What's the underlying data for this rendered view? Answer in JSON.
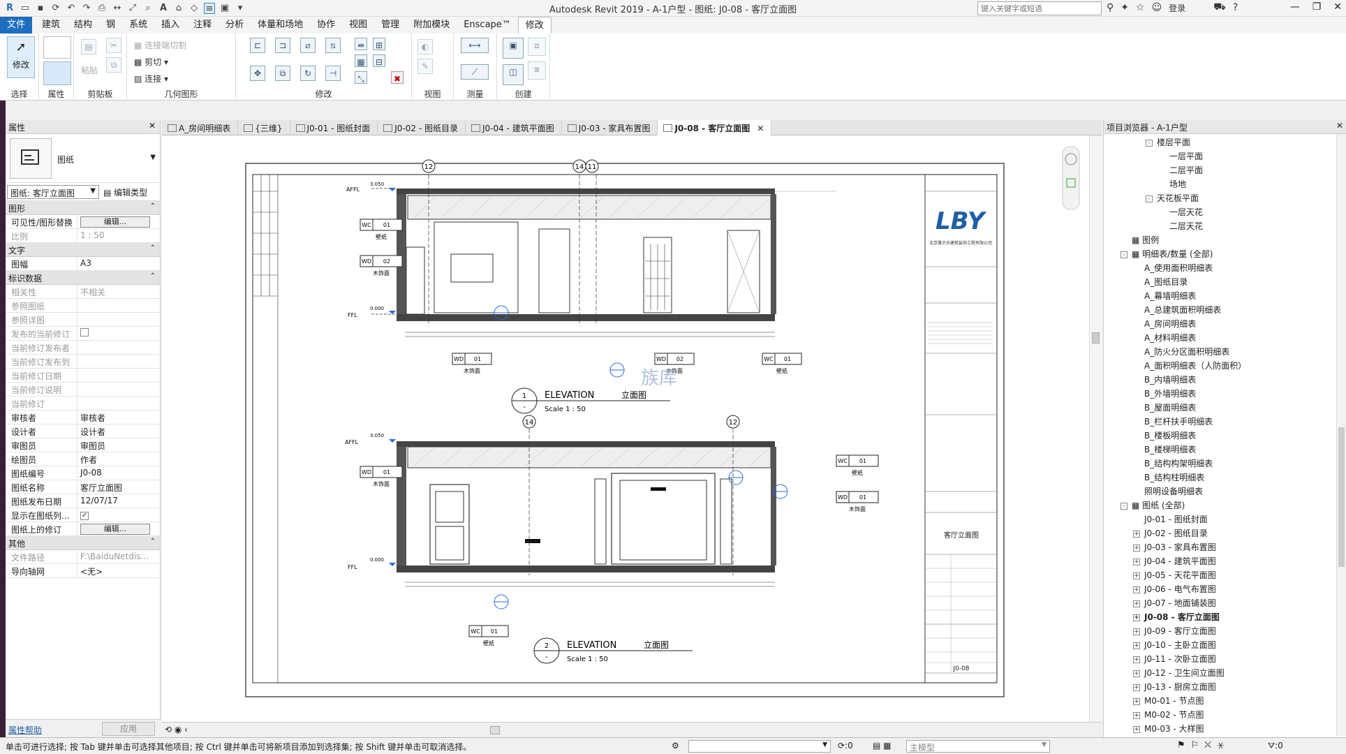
{
  "app": {
    "title": "Autodesk Revit 2019 - A-1户型 - 图纸: J0-08 - 客厅立面图",
    "search_placeholder": "键入关键字或短语",
    "login": "登录"
  },
  "menu": [
    "文件",
    "建筑",
    "结构",
    "钢",
    "系统",
    "插入",
    "注释",
    "分析",
    "体量和场地",
    "协作",
    "视图",
    "管理",
    "附加模块",
    "Enscape™",
    "修改"
  ],
  "ribbon": {
    "panels": [
      "选择",
      "属性",
      "剪贴板",
      "几何图形",
      "修改",
      "视图",
      "测量",
      "创建"
    ],
    "modify_label": "修改",
    "paste_label": "粘贴",
    "cut_label": "剪切",
    "join_label": "连接",
    "cutjoin_label": "连接端切割"
  },
  "properties": {
    "title": "属性",
    "family": "图纸",
    "selector": "图纸: 客厅立面图",
    "edit_type": "编辑类型",
    "sections": [
      {
        "name": "图形",
        "rows": [
          {
            "k": "可见性/图形替换",
            "v": "编辑...",
            "btn": true
          },
          {
            "k": "比例",
            "v": "1 : 50",
            "dim": true
          }
        ]
      },
      {
        "name": "文字",
        "rows": [
          {
            "k": "图幅",
            "v": "A3"
          }
        ]
      },
      {
        "name": "标识数据",
        "rows": [
          {
            "k": "相关性",
            "v": "不相关",
            "dim": true
          },
          {
            "k": "参照图纸",
            "v": "",
            "dim": true
          },
          {
            "k": "参照详图",
            "v": "",
            "dim": true
          },
          {
            "k": "发布的当前修订",
            "v": "",
            "dim": true,
            "chk": true,
            "checked": false
          },
          {
            "k": "当前修订发布者",
            "v": "",
            "dim": true
          },
          {
            "k": "当前修订发布到",
            "v": "",
            "dim": true
          },
          {
            "k": "当前修订日期",
            "v": "",
            "dim": true
          },
          {
            "k": "当前修订说明",
            "v": "",
            "dim": true
          },
          {
            "k": "当前修订",
            "v": "",
            "dim": true
          },
          {
            "k": "审核者",
            "v": "审核者"
          },
          {
            "k": "设计者",
            "v": "设计者"
          },
          {
            "k": "审图员",
            "v": "审图员"
          },
          {
            "k": "绘图员",
            "v": "作者"
          },
          {
            "k": "图纸编号",
            "v": "J0-08"
          },
          {
            "k": "图纸名称",
            "v": "客厅立面图"
          },
          {
            "k": "图纸发布日期",
            "v": "12/07/17"
          },
          {
            "k": "显示在图纸列...",
            "v": "",
            "chk": true,
            "checked": true
          },
          {
            "k": "图纸上的修订",
            "v": "编辑...",
            "btn": true
          }
        ]
      },
      {
        "name": "其他",
        "rows": [
          {
            "k": "文件路径",
            "v": "F:\\BaiduNetdis...",
            "dim": true
          },
          {
            "k": "导向轴网",
            "v": "<无>"
          }
        ]
      }
    ],
    "help": "属性帮助",
    "apply": "应用"
  },
  "tabs": [
    {
      "label": "A_房间明细表",
      "active": false
    },
    {
      "label": "{三维}",
      "active": false
    },
    {
      "label": "J0-01 - 图纸封面",
      "active": false
    },
    {
      "label": "J0-02 - 图纸目录",
      "active": false
    },
    {
      "label": "J0-04 - 建筑平面图",
      "active": false
    },
    {
      "label": "J0-03 - 家具布置图",
      "active": false
    },
    {
      "label": "J0-08 - 客厅立面图",
      "active": true
    }
  ],
  "sheet": {
    "logo": "LBY",
    "company": "北京雅贝乐建筑装饰工程有限公司",
    "drawing_title": "客厅立面图",
    "sheet_no": "J0-08",
    "views": [
      {
        "num": "1",
        "sub": "-",
        "title": "ELEVATION",
        "title_cn": "立面图",
        "scale": "Scale    1 : 50"
      },
      {
        "num": "2",
        "sub": "-",
        "title": "ELEVATION",
        "title_cn": "立面图",
        "scale": "Scale    1 : 50"
      }
    ],
    "grids_top": [
      "12",
      "14",
      "11"
    ],
    "grids_bottom": [
      "14",
      "12"
    ],
    "levels": [
      {
        "name": "AFFL",
        "val": "3.050"
      },
      {
        "name": "FFL",
        "val": "0.000"
      }
    ],
    "tags_top": [
      {
        "code": "WC",
        "num": "01",
        "label": "壁纸"
      },
      {
        "code": "WD",
        "num": "02",
        "label": "木饰面"
      },
      {
        "code": "WD",
        "num": "01",
        "label": "木饰面"
      },
      {
        "code": "WD",
        "num": "02",
        "label": "木饰面"
      },
      {
        "code": "WC",
        "num": "01",
        "label": "壁纸"
      }
    ],
    "tags_bottom": [
      {
        "code": "WD",
        "num": "01",
        "label": "木饰面"
      },
      {
        "code": "WC",
        "num": "01",
        "label": "壁纸"
      },
      {
        "code": "WD",
        "num": "01",
        "label": "木饰面"
      },
      {
        "code": "WC",
        "num": "01",
        "label": "壁纸"
      }
    ],
    "watermark": "族库"
  },
  "browser": {
    "title": "项目浏览器 - A-1户型",
    "nodes": [
      {
        "t": "楼层平面",
        "lvl": 2,
        "tg": "-"
      },
      {
        "t": "一层平面",
        "lvl": 3
      },
      {
        "t": "二层平面",
        "lvl": 3
      },
      {
        "t": "场地",
        "lvl": 3
      },
      {
        "t": "天花板平面",
        "lvl": 2,
        "tg": "-"
      },
      {
        "t": "一层天花",
        "lvl": 3
      },
      {
        "t": "二层天花",
        "lvl": 3
      },
      {
        "t": "图例",
        "lvl": 0
      },
      {
        "t": "明细表/数量 (全部)",
        "lvl": 0,
        "tg": "-"
      },
      {
        "t": "A_使用面积明细表",
        "lvl": 1
      },
      {
        "t": "A_图纸目录",
        "lvl": 1
      },
      {
        "t": "A_幕墙明细表",
        "lvl": 1
      },
      {
        "t": "A_总建筑面积明细表",
        "lvl": 1
      },
      {
        "t": "A_房间明细表",
        "lvl": 1
      },
      {
        "t": "A_材料明细表",
        "lvl": 1
      },
      {
        "t": "A_防火分区面积明细表",
        "lvl": 1
      },
      {
        "t": "A_面积明细表（人防面积）",
        "lvl": 1
      },
      {
        "t": "B_内墙明细表",
        "lvl": 1
      },
      {
        "t": "B_外墙明细表",
        "lvl": 1
      },
      {
        "t": "B_屋面明细表",
        "lvl": 1
      },
      {
        "t": "B_栏杆扶手明细表",
        "lvl": 1
      },
      {
        "t": "B_楼板明细表",
        "lvl": 1
      },
      {
        "t": "B_楼梯明细表",
        "lvl": 1
      },
      {
        "t": "B_结构构架明细表",
        "lvl": 1
      },
      {
        "t": "B_结构柱明细表",
        "lvl": 1
      },
      {
        "t": "照明设备明细表",
        "lvl": 1
      },
      {
        "t": "图纸 (全部)",
        "lvl": 0,
        "tg": "-"
      },
      {
        "t": "J0-01 - 图纸封面",
        "lvl": 1
      },
      {
        "t": "J0-02 - 图纸目录",
        "lvl": 1,
        "tg": "+"
      },
      {
        "t": "J0-03 - 家具布置图",
        "lvl": 1,
        "tg": "+"
      },
      {
        "t": "J0-04 - 建筑平面图",
        "lvl": 1,
        "tg": "+"
      },
      {
        "t": "J0-05 - 天花平面图",
        "lvl": 1,
        "tg": "+"
      },
      {
        "t": "J0-06 - 电气布置图",
        "lvl": 1,
        "tg": "+"
      },
      {
        "t": "J0-07 - 地面铺装图",
        "lvl": 1,
        "tg": "+"
      },
      {
        "t": "J0-08 - 客厅立面图",
        "lvl": 1,
        "tg": "+",
        "bold": true
      },
      {
        "t": "J0-09 - 客厅立面图",
        "lvl": 1,
        "tg": "+"
      },
      {
        "t": "J0-10 - 主卧立面图",
        "lvl": 1,
        "tg": "+"
      },
      {
        "t": "J0-11 - 次卧立面图",
        "lvl": 1,
        "tg": "+"
      },
      {
        "t": "J0-12 - 卫生间立面图",
        "lvl": 1,
        "tg": "+"
      },
      {
        "t": "J0-13 - 厨房立面图",
        "lvl": 1,
        "tg": "+"
      },
      {
        "t": "M0-01 - 节点图",
        "lvl": 1,
        "tg": "+"
      },
      {
        "t": "M0-02 - 节点图",
        "lvl": 1,
        "tg": "+"
      },
      {
        "t": "M0-03 - 大样图",
        "lvl": 1,
        "tg": "+"
      }
    ]
  },
  "status": {
    "text": "单击可进行选择; 按 Tab 键并单击可选择其他项目; 按 Ctrl 键并单击可将新项目添加到选择集; 按 Shift 键并单击可取消选择。",
    "zero": ":0",
    "model": "主模型",
    "filter": ":0"
  }
}
